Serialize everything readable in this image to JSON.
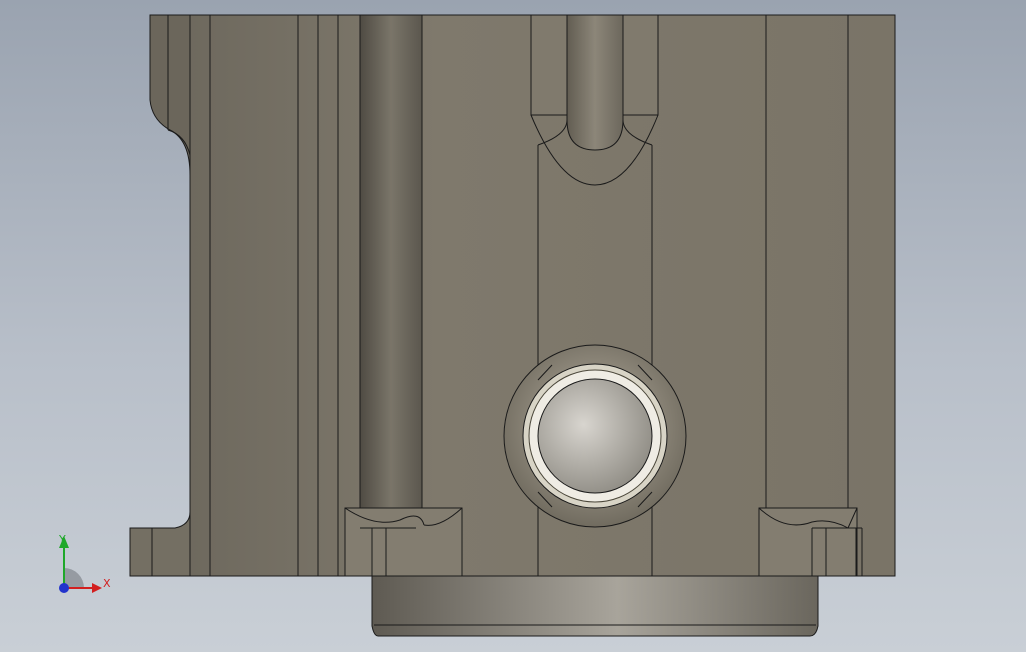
{
  "viewport": {
    "background_top": "#9aa3b0",
    "background_bottom": "#c9cfd6"
  },
  "model": {
    "body_color": "#7d776a",
    "edge_color": "#1a1a1a",
    "boss_color": "#d8d4cc"
  },
  "triad": {
    "x_label": "X",
    "y_label": "Y",
    "x_color": "#d21f1f",
    "y_color": "#1fa82a",
    "z_color": "#2233cc"
  }
}
